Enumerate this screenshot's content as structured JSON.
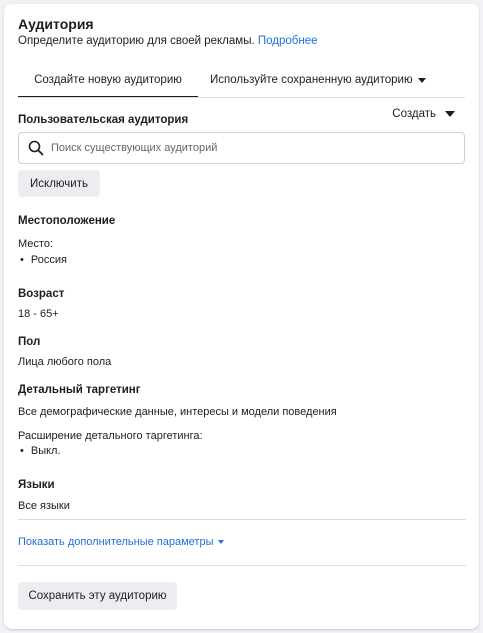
{
  "header": {
    "title": "Аудитория",
    "subtitle": "Определите аудиторию для своей рекламы.",
    "subtitle_link": "Подробнее"
  },
  "tabs": [
    {
      "label": "Создайте новую аудиторию",
      "active": true
    },
    {
      "label": "Используйте сохраненную аудиторию",
      "active": false
    }
  ],
  "custom_audience": {
    "label": "Пользовательская аудитория",
    "create_label": "Создать",
    "search_placeholder": "Поиск существующих аудиторий",
    "exclude_label": "Исключить"
  },
  "location": {
    "heading": "Местоположение",
    "place_label": "Место:",
    "places": [
      "Россия"
    ]
  },
  "age": {
    "heading": "Возраст",
    "value": "18 - 65+"
  },
  "gender": {
    "heading": "Пол",
    "value": "Лица любого пола"
  },
  "detailed_targeting": {
    "heading": "Детальный таргетинг",
    "value": "Все демографические данные, интересы и модели поведения",
    "expansion_label": "Расширение детального таргетинга:",
    "expansion_items": [
      "Выкл."
    ]
  },
  "languages": {
    "heading": "Языки",
    "value": "Все языки"
  },
  "more_options_label": "Показать дополнительные параметры",
  "save_audience_label": "Сохранить эту аудиторию",
  "colors": {
    "link": "#216fdb",
    "text": "#1c1e21",
    "button_bg": "#ebedf0",
    "border": "#ccd0d5",
    "page_bg": "#f0f2f5"
  },
  "icons": {
    "search": "search-icon",
    "dropdown": "caret-down-icon"
  }
}
